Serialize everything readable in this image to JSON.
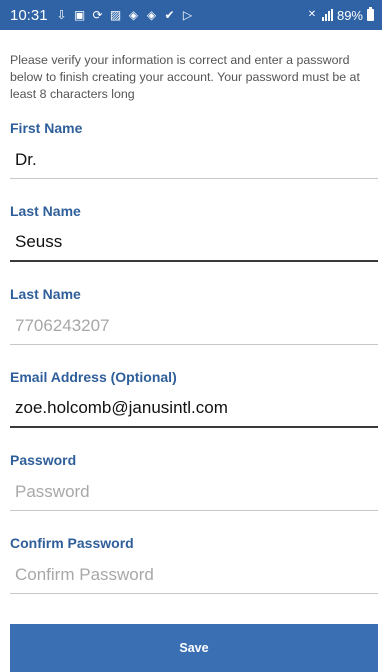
{
  "status_bar": {
    "time": "10:31",
    "battery_percent": "89%",
    "icons": [
      "download-icon",
      "gallery-icon",
      "sync-icon",
      "image-icon",
      "dropbox-icon",
      "dropbox-icon",
      "check-icon",
      "play-store-icon"
    ]
  },
  "form": {
    "intro_text": "Please verify your information is correct and enter a password below to finish creating your account. Your password must be at least 8 characters long",
    "first_name": {
      "label": "First Name",
      "value": "Dr."
    },
    "last_name": {
      "label": "Last Name",
      "value": "Seuss"
    },
    "phone": {
      "label": "Last Name",
      "placeholder": "7706243207"
    },
    "email": {
      "label": "Email Address (Optional)",
      "value": "zoe.holcomb@janusintl.com"
    },
    "password": {
      "label": "Password",
      "placeholder": "Password"
    },
    "confirm_password": {
      "label": "Confirm Password",
      "placeholder": "Confirm Password"
    },
    "save_label": "Save"
  },
  "colors": {
    "status_bar": "#2f63a6",
    "label": "#2f5f9a",
    "button": "#3b6fb3"
  }
}
